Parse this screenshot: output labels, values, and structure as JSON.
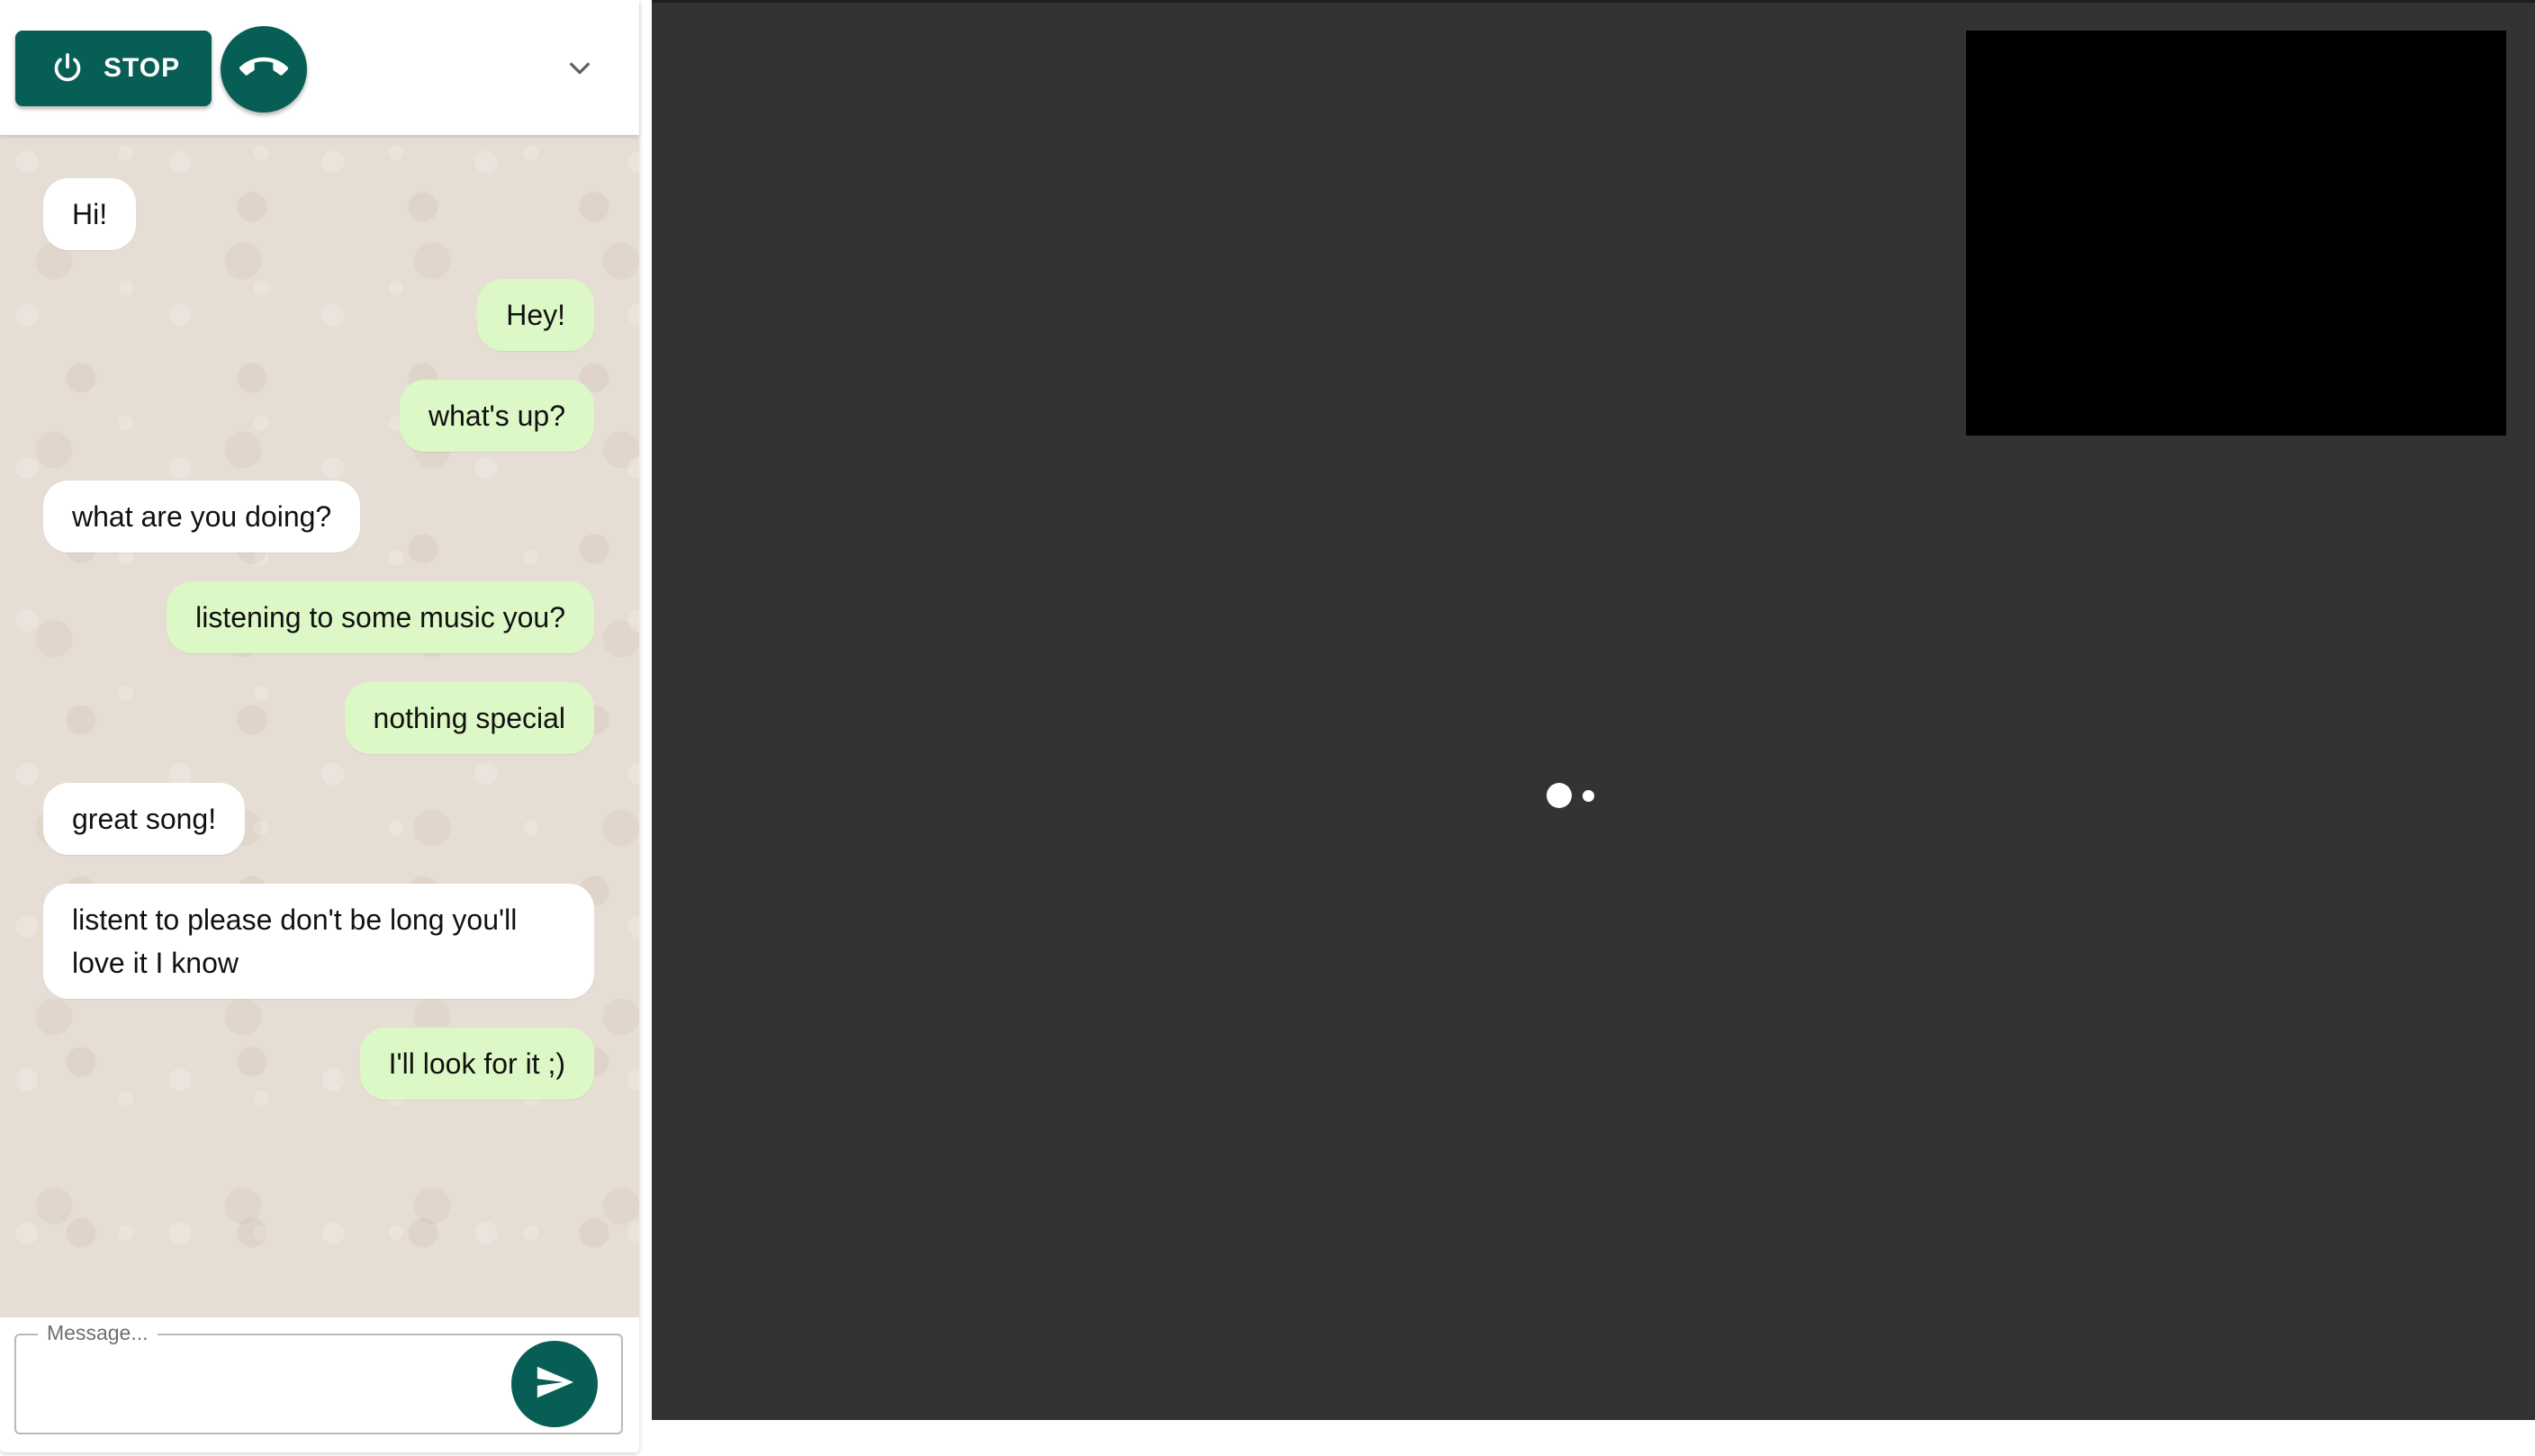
{
  "header": {
    "stop_label": "STOP",
    "stop_icon": "power-icon",
    "hangup_icon": "phone-hangup-icon",
    "collapse_icon": "chevron-down-icon"
  },
  "messages": [
    {
      "side": "received",
      "text": "Hi!"
    },
    {
      "side": "sent",
      "text": "Hey!"
    },
    {
      "side": "sent",
      "text": "what's up?"
    },
    {
      "side": "received",
      "text": "what are you doing?"
    },
    {
      "side": "sent",
      "text": "listening to some music you?"
    },
    {
      "side": "sent",
      "text": "nothing special"
    },
    {
      "side": "received",
      "text": "great song!"
    },
    {
      "side": "received",
      "text": "listent to please don't be long you'll love it I know"
    },
    {
      "side": "sent",
      "text": "I'll look for it ;)"
    }
  ],
  "composer": {
    "placeholder": "Message...",
    "value": "",
    "send_icon": "send-icon"
  },
  "colors": {
    "accent": "#075e54",
    "sent_bubble": "#dcf8c6",
    "received_bubble": "#ffffff",
    "chat_background": "#e6ddd4",
    "video_background": "#333333",
    "self_view": "#000000"
  }
}
